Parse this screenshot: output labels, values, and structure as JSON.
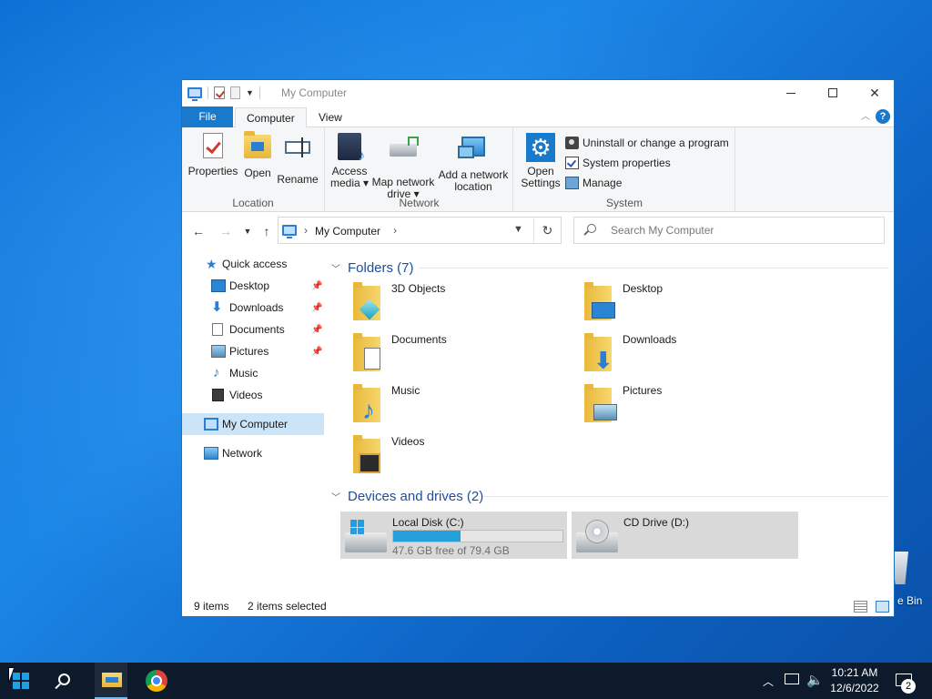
{
  "window": {
    "title": "My Computer",
    "tabs": {
      "file": "File",
      "computer": "Computer",
      "view": "View"
    },
    "help_label": "?"
  },
  "ribbon": {
    "location": {
      "group_label": "Location",
      "properties": "Properties",
      "open": "Open",
      "rename": "Rename"
    },
    "network": {
      "group_label": "Network",
      "access_media_line1": "Access",
      "access_media_line2": "media ▾",
      "map_drive_line1": "Map network",
      "map_drive_line2": "drive ▾",
      "add_location_line1": "Add a network",
      "add_location_line2": "location"
    },
    "system": {
      "group_label": "System",
      "open_settings_line1": "Open",
      "open_settings_line2": "Settings",
      "uninstall": "Uninstall or change a program",
      "system_properties": "System properties",
      "manage": "Manage"
    }
  },
  "address_bar": {
    "path": "My Computer",
    "search_placeholder": "Search My Computer"
  },
  "nav_pane": {
    "quick_access": "Quick access",
    "quick_items": [
      {
        "label": "Desktop",
        "pinned": true
      },
      {
        "label": "Downloads",
        "pinned": true
      },
      {
        "label": "Documents",
        "pinned": true
      },
      {
        "label": "Pictures",
        "pinned": true
      },
      {
        "label": "Music",
        "pinned": false
      },
      {
        "label": "Videos",
        "pinned": false
      }
    ],
    "my_computer": "My Computer",
    "network": "Network"
  },
  "content": {
    "folders_header": "Folders (7)",
    "folders": [
      "3D Objects",
      "Desktop",
      "Documents",
      "Downloads",
      "Music",
      "Pictures",
      "Videos"
    ],
    "drives_header": "Devices and drives (2)",
    "drives": [
      {
        "name": "Local Disk (C:)",
        "free_text": "47.6 GB free of 79.4 GB",
        "used_fraction": 0.4
      },
      {
        "name": "CD Drive (D:)"
      }
    ]
  },
  "status_bar": {
    "item_count": "9 items",
    "selection": "2 items selected"
  },
  "desktop": {
    "recycle_bin_label": "e Bin"
  },
  "taskbar": {
    "time": "10:21 AM",
    "date": "12/6/2022",
    "notification_count": "2"
  },
  "colors": {
    "accent": "#1979ca",
    "selection": "#cce4f7",
    "group_header": "#1f4e99",
    "progress": "#26a0da",
    "taskbar": "#0d1a2b"
  }
}
